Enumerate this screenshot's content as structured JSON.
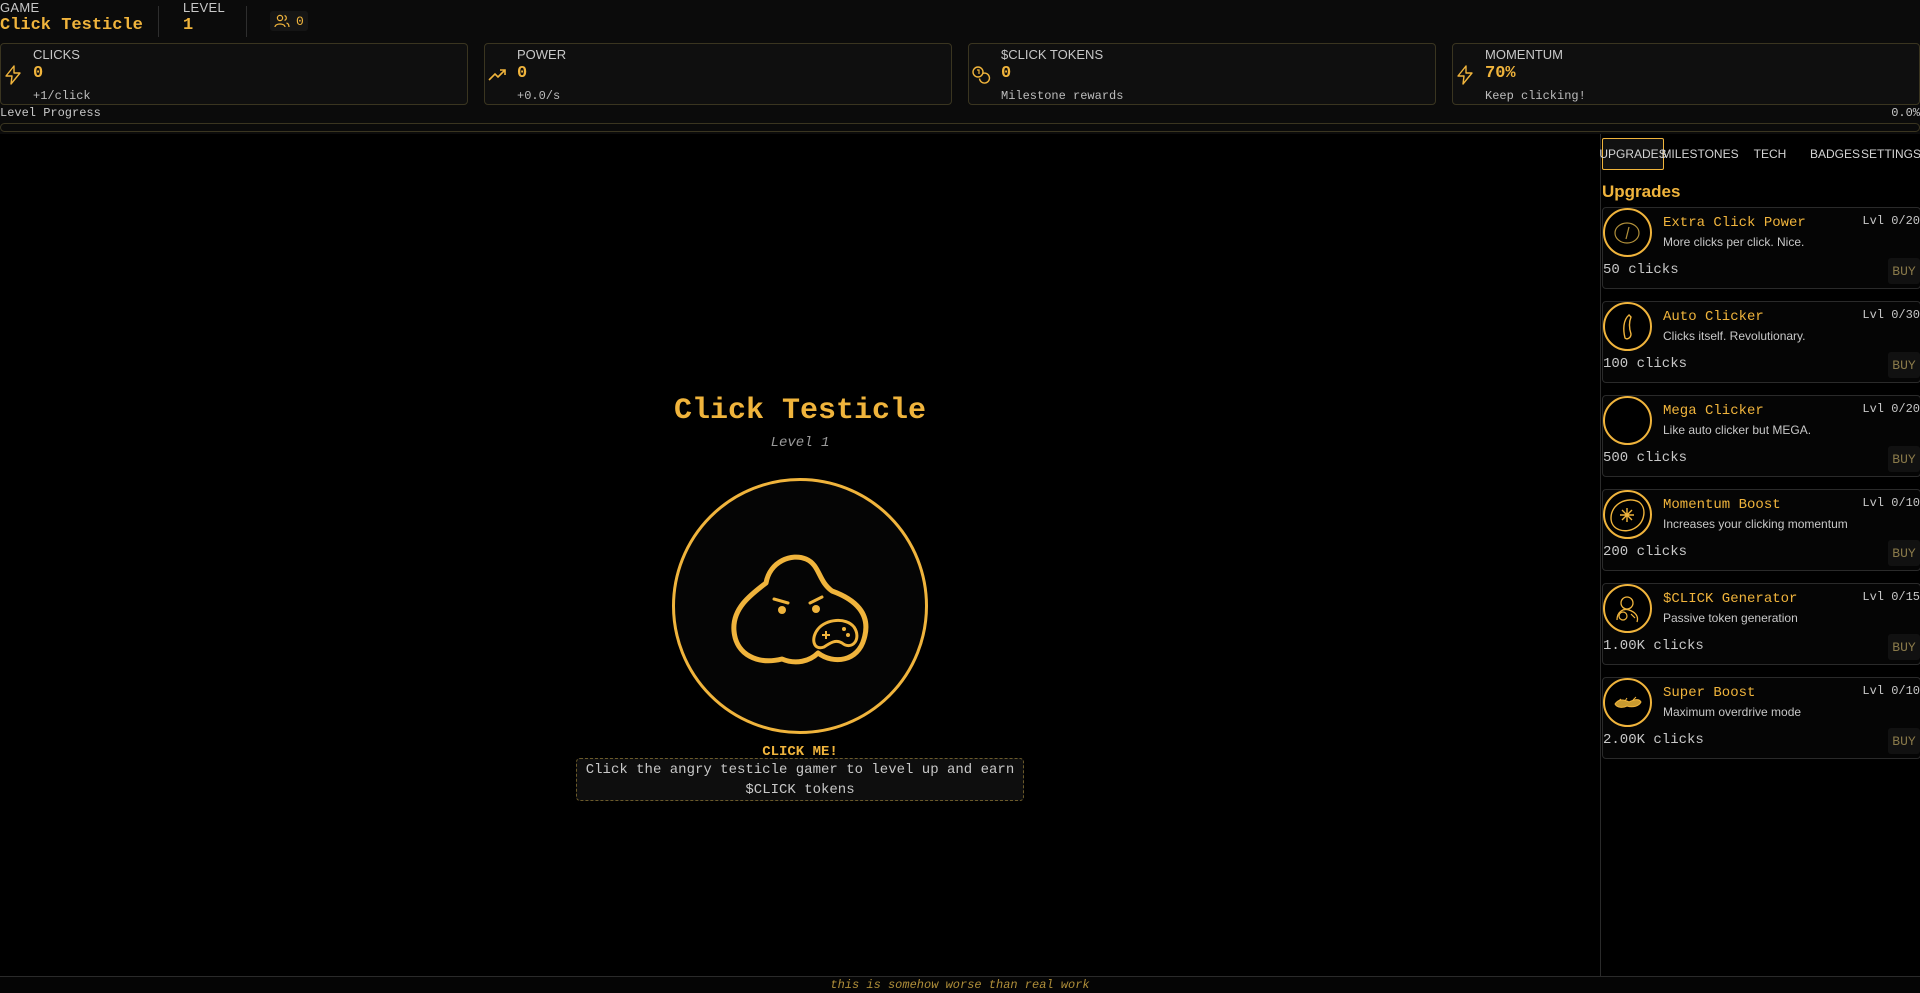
{
  "header": {
    "game_label": "GAME",
    "game_name": "Click Testicle",
    "level_label": "LEVEL",
    "level_value": "1",
    "players_count": "0"
  },
  "stats": [
    {
      "label": "CLICKS",
      "value": "0",
      "sub": "+1/click",
      "icon": "lightning-icon"
    },
    {
      "label": "POWER",
      "value": "0",
      "sub": "+0.0/s",
      "icon": "trending-up-icon"
    },
    {
      "label": "$CLICK TOKENS",
      "value": "0",
      "sub": "Milestone rewards",
      "icon": "coins-icon"
    },
    {
      "label": "MOMENTUM",
      "value": "70%",
      "sub": "Keep clicking!",
      "icon": "lightning-icon"
    }
  ],
  "progress": {
    "label": "Level Progress",
    "percent_text": "0.0%",
    "fraction": 0.0
  },
  "main": {
    "title": "Click Testicle",
    "level_text": "Level 1",
    "click_me": "CLICK ME!",
    "hint": "Click the angry testicle gamer to level up and earn $CLICK tokens"
  },
  "sidebar": {
    "tabs": [
      "UPGRADES",
      "MILESTONES",
      "TECH",
      "BADGES",
      "SETTINGS"
    ],
    "active_tab": "UPGRADES",
    "title": "Upgrades",
    "upgrades": [
      {
        "name": "Extra Click Power",
        "desc": "More clicks per click. Nice.",
        "level": "Lvl 0/20",
        "cost": "50 clicks",
        "buy": "BUY"
      },
      {
        "name": "Auto Clicker",
        "desc": "Clicks itself. Revolutionary.",
        "level": "Lvl 0/30",
        "cost": "100 clicks",
        "buy": "BUY"
      },
      {
        "name": "Mega Clicker",
        "desc": "Like auto clicker but MEGA.",
        "level": "Lvl 0/20",
        "cost": "500 clicks",
        "buy": "BUY"
      },
      {
        "name": "Momentum Boost",
        "desc": "Increases your clicking momentum",
        "level": "Lvl 0/10",
        "cost": "200 clicks",
        "buy": "BUY"
      },
      {
        "name": "$CLICK Generator",
        "desc": "Passive token generation",
        "level": "Lvl 0/15",
        "cost": "1.00K clicks",
        "buy": "BUY"
      },
      {
        "name": "Super Boost",
        "desc": "Maximum overdrive mode",
        "level": "Lvl 0/10",
        "cost": "2.00K clicks",
        "buy": "BUY"
      }
    ]
  },
  "footer": {
    "text": "this is somehow worse than real work"
  },
  "colors": {
    "accent": "#f0b43c",
    "background": "#000000",
    "card_border": "#3a3520"
  }
}
